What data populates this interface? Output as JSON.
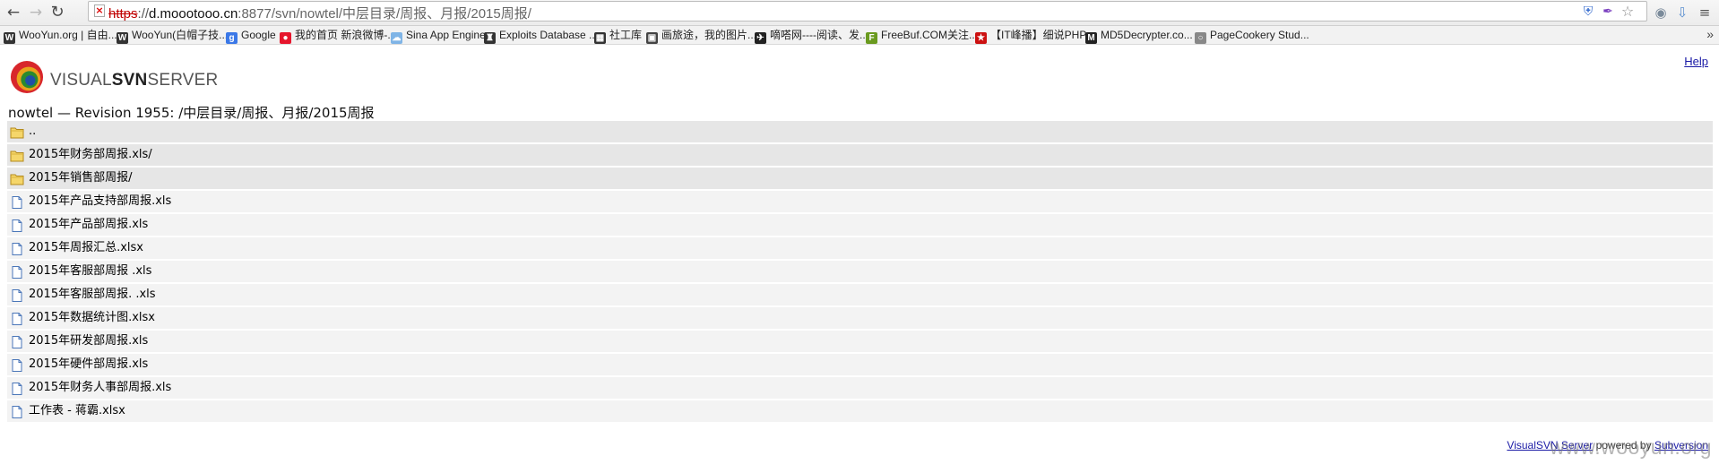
{
  "browser": {
    "url_scheme": "https",
    "url_sep": "://",
    "url_host": "d.moootooo.cn",
    "url_path": ":8877/svn/nowtel/中层目录/周报、月报/2015周报/",
    "bookmarks": [
      {
        "label": "WooYun.org | 自由...",
        "icon": "wooyun-icon",
        "color": "#333333"
      },
      {
        "label": "WooYun(白帽子技...",
        "icon": "wooyun-icon",
        "color": "#333333"
      },
      {
        "label": "Google",
        "icon": "google-icon",
        "color": "#3b78e7"
      },
      {
        "label": "我的首页 新浪微博-...",
        "icon": "weibo-icon",
        "color": "#e6162d"
      },
      {
        "label": "Sina App Engine",
        "icon": "cloud-icon",
        "color": "#7fb4e6"
      },
      {
        "label": "Exploits Database ...",
        "icon": "exploitdb-icon",
        "color": "#333333"
      },
      {
        "label": "社工库",
        "icon": "tag-icon",
        "color": "#333333"
      },
      {
        "label": "画旅途，我的图片...",
        "icon": "photo-icon",
        "color": "#444444"
      },
      {
        "label": "嘀嗒网----阅读、发...",
        "icon": "bird-icon",
        "color": "#222222"
      },
      {
        "label": "FreeBuf.COM关注...",
        "icon": "freebuf-icon",
        "color": "#6a9a1f"
      },
      {
        "label": "【IT峰播】细说PHP...",
        "icon": "star-icon",
        "color": "#cc1111"
      },
      {
        "label": "MD5Decrypter.co...",
        "icon": "md5-icon",
        "color": "#222222"
      },
      {
        "label": "PageCookery Stud...",
        "icon": "globe-icon",
        "color": "#888888"
      }
    ],
    "more_label": "»"
  },
  "page": {
    "help_label": "Help",
    "brand_light_1": "VISUAL",
    "brand_bold": "SVN",
    "brand_light_2": "SERVER",
    "title": "nowtel — Revision 1955: /中层目录/周报、月报/2015周报",
    "entries": [
      {
        "type": "dir",
        "name": ".."
      },
      {
        "type": "dir",
        "name": "2015年财务部周报.xls/"
      },
      {
        "type": "dir",
        "name": "2015年销售部周报/"
      },
      {
        "type": "file",
        "name": "2015年产品支持部周报.xls"
      },
      {
        "type": "file",
        "name": "2015年产品部周报.xls"
      },
      {
        "type": "file",
        "name": "2015年周报汇总.xlsx"
      },
      {
        "type": "file",
        "name": "2015年客服部周报 .xls"
      },
      {
        "type": "file",
        "name": "2015年客服部周报. .xls"
      },
      {
        "type": "file",
        "name": "2015年数据统计图.xlsx"
      },
      {
        "type": "file",
        "name": "2015年研发部周报.xls"
      },
      {
        "type": "file",
        "name": "2015年硬件部周报.xls"
      },
      {
        "type": "file",
        "name": "2015年财务人事部周报.xls"
      },
      {
        "type": "file",
        "name": "工作表 - 蒋霸.xlsx"
      }
    ],
    "footer_link1": "VisualSVN Server",
    "footer_text": " powered by ",
    "footer_link2": "Subversion",
    "watermark": "www.wooyun.org"
  }
}
